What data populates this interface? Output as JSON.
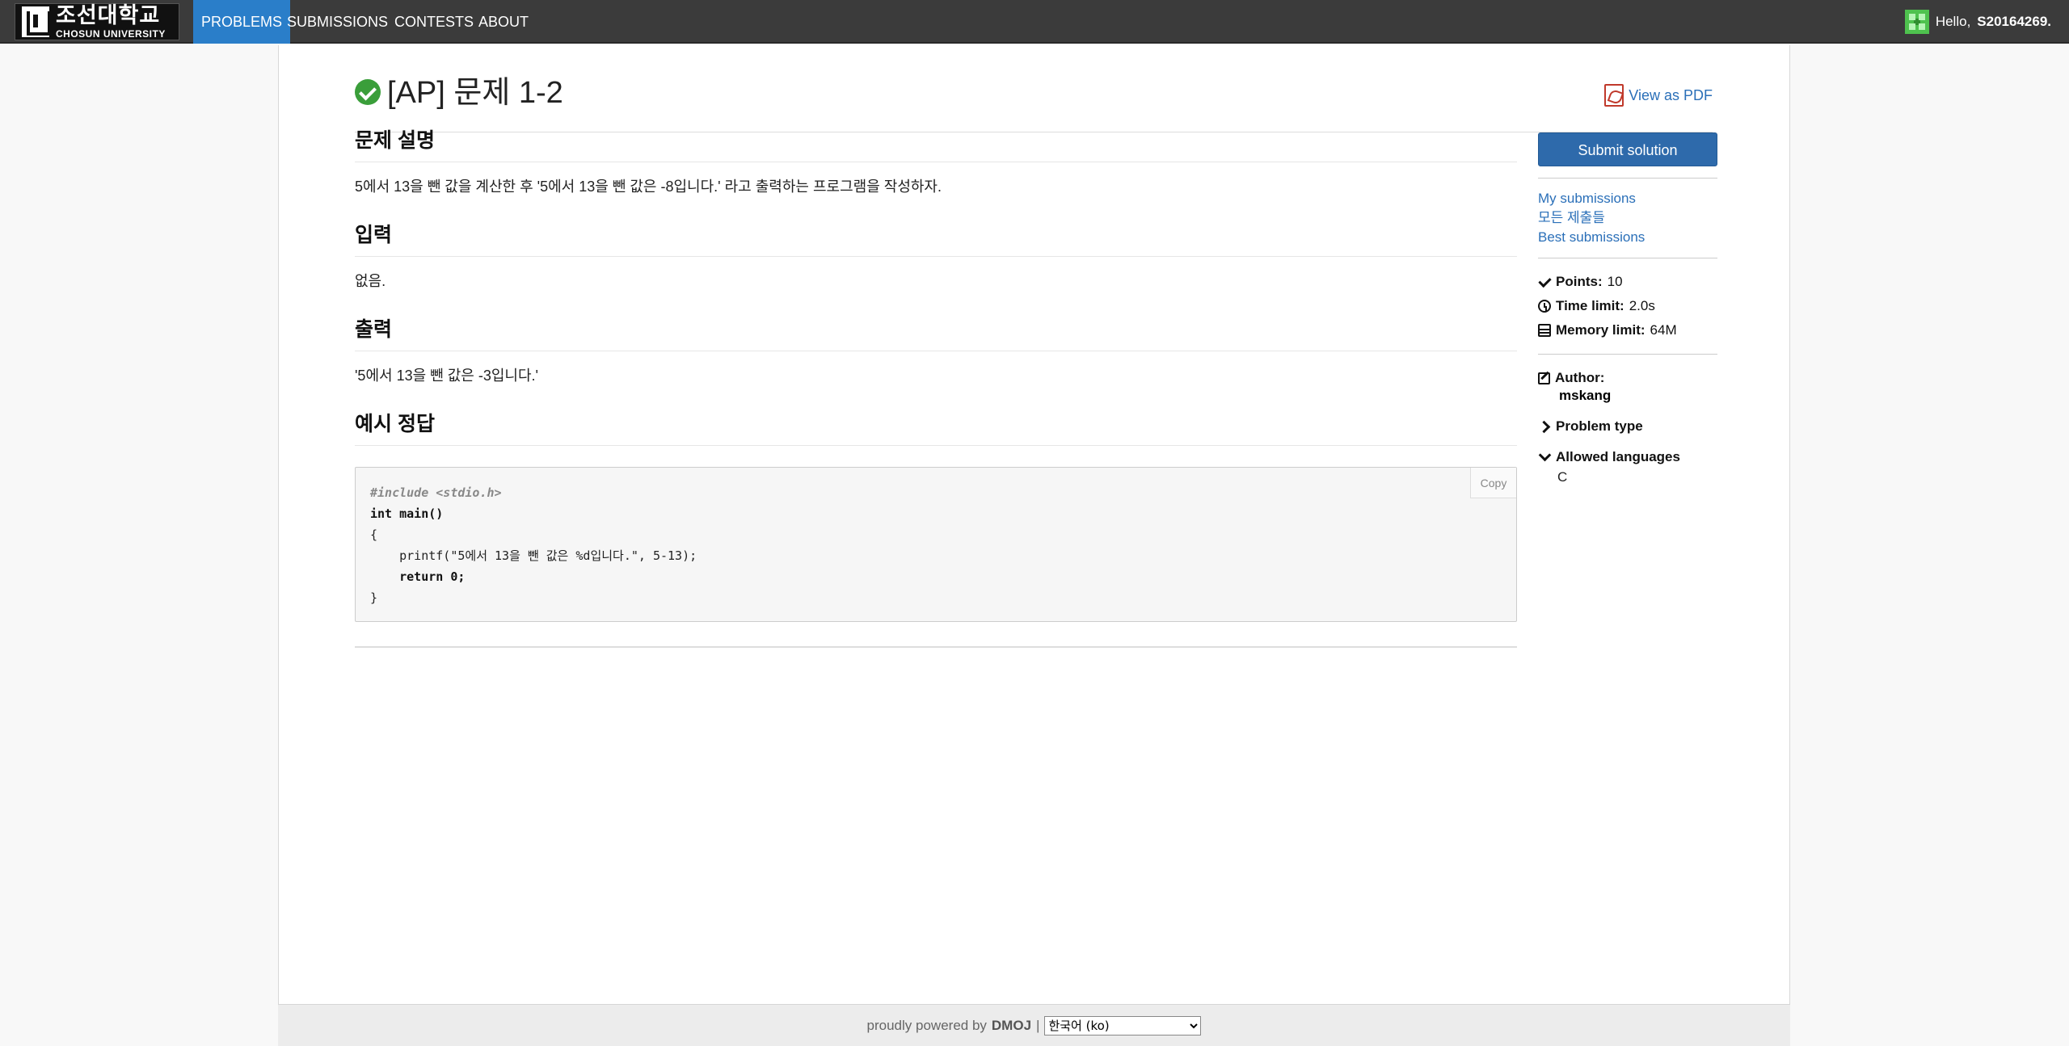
{
  "logo": {
    "korean": "조선대학교",
    "english": "CHOSUN UNIVERSITY"
  },
  "nav": {
    "items": [
      {
        "label": "PROBLEMS",
        "active": true
      },
      {
        "label": "SUBMISSIONS",
        "active": false
      },
      {
        "label": "CONTESTS",
        "active": false
      },
      {
        "label": "ABOUT",
        "active": false
      }
    ],
    "greeting": "Hello,",
    "username": "S20164269."
  },
  "problem": {
    "title": "[AP] 문제 1-2",
    "solved": true,
    "pdf_label": "View as PDF",
    "sections": [
      {
        "heading": "문제 설명",
        "text": "5에서 13을 뺀 값을 계산한 후 '5에서 13을 뺀 값은 -8입니다.' 라고 출력하는 프로그램을 작성하자."
      },
      {
        "heading": "입력",
        "text": "없음."
      },
      {
        "heading": "출력",
        "text": "'5에서 13을 뺀 값은 -3입니다.'"
      },
      {
        "heading": "예시 정답"
      }
    ],
    "code": {
      "lines": [
        "#include <stdio.h>",
        "int main()",
        "{",
        "    printf(\"5에서 13을 뺀 값은 %d입니다.\", 5-13);",
        "    return 0;",
        "}"
      ],
      "copy_label": "Copy"
    }
  },
  "sidebar": {
    "submit_label": "Submit solution",
    "links": [
      "My submissions",
      "모든 제출들",
      "Best submissions"
    ],
    "points_label": "Points:",
    "points_value": "10",
    "time_label": "Time limit:",
    "time_value": "2.0s",
    "memory_label": "Memory limit:",
    "memory_value": "64M",
    "author_label": "Author:",
    "author_name": "mskang",
    "problem_type_label": "Problem type",
    "allowed_languages_label": "Allowed languages",
    "allowed_languages": [
      "C"
    ]
  },
  "footer": {
    "powered_text": "proudly powered by",
    "brand": "DMOJ",
    "separator": "|",
    "language_selected": "한국어 (ko)"
  }
}
